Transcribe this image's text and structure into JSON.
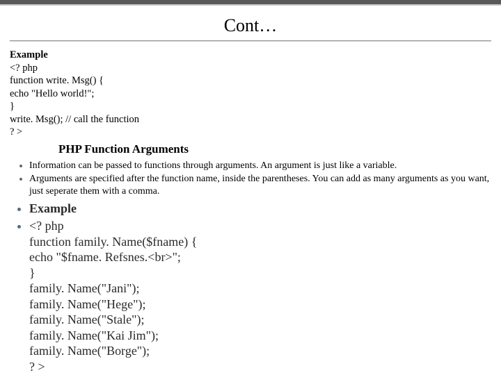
{
  "slide": {
    "title": "Cont…",
    "example_label": "Example",
    "code1": {
      "l1": "<? php",
      "l2": "function write. Msg() {",
      "l3": "  echo \"Hello world!\";",
      "l4": "}",
      "l5": "write. Msg(); // call the function",
      "l6": "? >"
    },
    "subheading": "PHP Function Arguments",
    "bullets": {
      "b1": "Information can be passed to functions through arguments. An argument is just like a variable.",
      "b2": "Arguments are specified after the function name, inside the parentheses. You can add as many arguments as you want, just seperate them with a comma."
    },
    "example2_label": "Example",
    "code2": {
      "l1": "<? php",
      "l2": "function family. Name($fname) {",
      "l3": "  echo \"$fname. Refsnes.<br>\";",
      "l4": "}",
      "l5": "family. Name(\"Jani\");",
      "l6": "family. Name(\"Hege\");",
      "l7": "family. Name(\"Stale\");",
      "l8": "family. Name(\"Kai Jim\");",
      "l9": "family. Name(\"Borge\");",
      "l10": "? >"
    }
  }
}
